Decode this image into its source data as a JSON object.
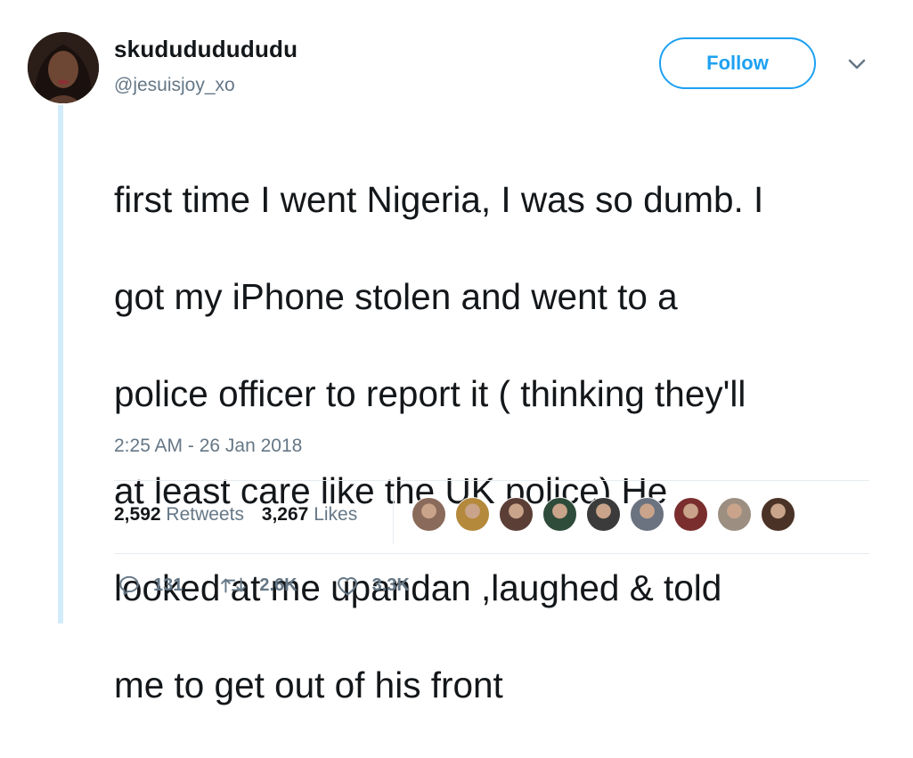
{
  "user": {
    "display_name": "skudududududu",
    "handle": "@jesuisjoy_xo"
  },
  "follow_button": {
    "label": "Follow"
  },
  "tweet": {
    "lines": [
      "first time I went Nigeria, I was so dumb. I",
      "got my iPhone stolen and went to a",
      "police officer to report it ( thinking they'll",
      "at least care like the UK police)  He",
      "looked at me upandan ,laughed & told",
      "me to get out of his front"
    ],
    "timestamp": "2:25 AM - 26 Jan 2018"
  },
  "stats": {
    "retweets_count": "2,592",
    "retweets_label": "Retweets",
    "likes_count": "3,267",
    "likes_label": "Likes"
  },
  "likers": [
    {
      "name": "liker-avatar-1",
      "color": "#8a6a5a"
    },
    {
      "name": "liker-avatar-2",
      "color": "#b5893c"
    },
    {
      "name": "liker-avatar-3",
      "color": "#5b3f36"
    },
    {
      "name": "liker-avatar-4",
      "color": "#2f4b3a"
    },
    {
      "name": "liker-avatar-5",
      "color": "#3b3b3b"
    },
    {
      "name": "liker-avatar-6",
      "color": "#6b7280"
    },
    {
      "name": "liker-avatar-7",
      "color": "#7a2e2e"
    },
    {
      "name": "liker-avatar-8",
      "color": "#9c8f82"
    },
    {
      "name": "liker-avatar-9",
      "color": "#4a3326"
    }
  ],
  "actions": {
    "replies": "131",
    "retweets": "2.6K",
    "likes": "3.3K"
  },
  "colors": {
    "accent": "#1da1f2",
    "secondary_text": "#657786",
    "thread_line": "#d3ecfb"
  }
}
